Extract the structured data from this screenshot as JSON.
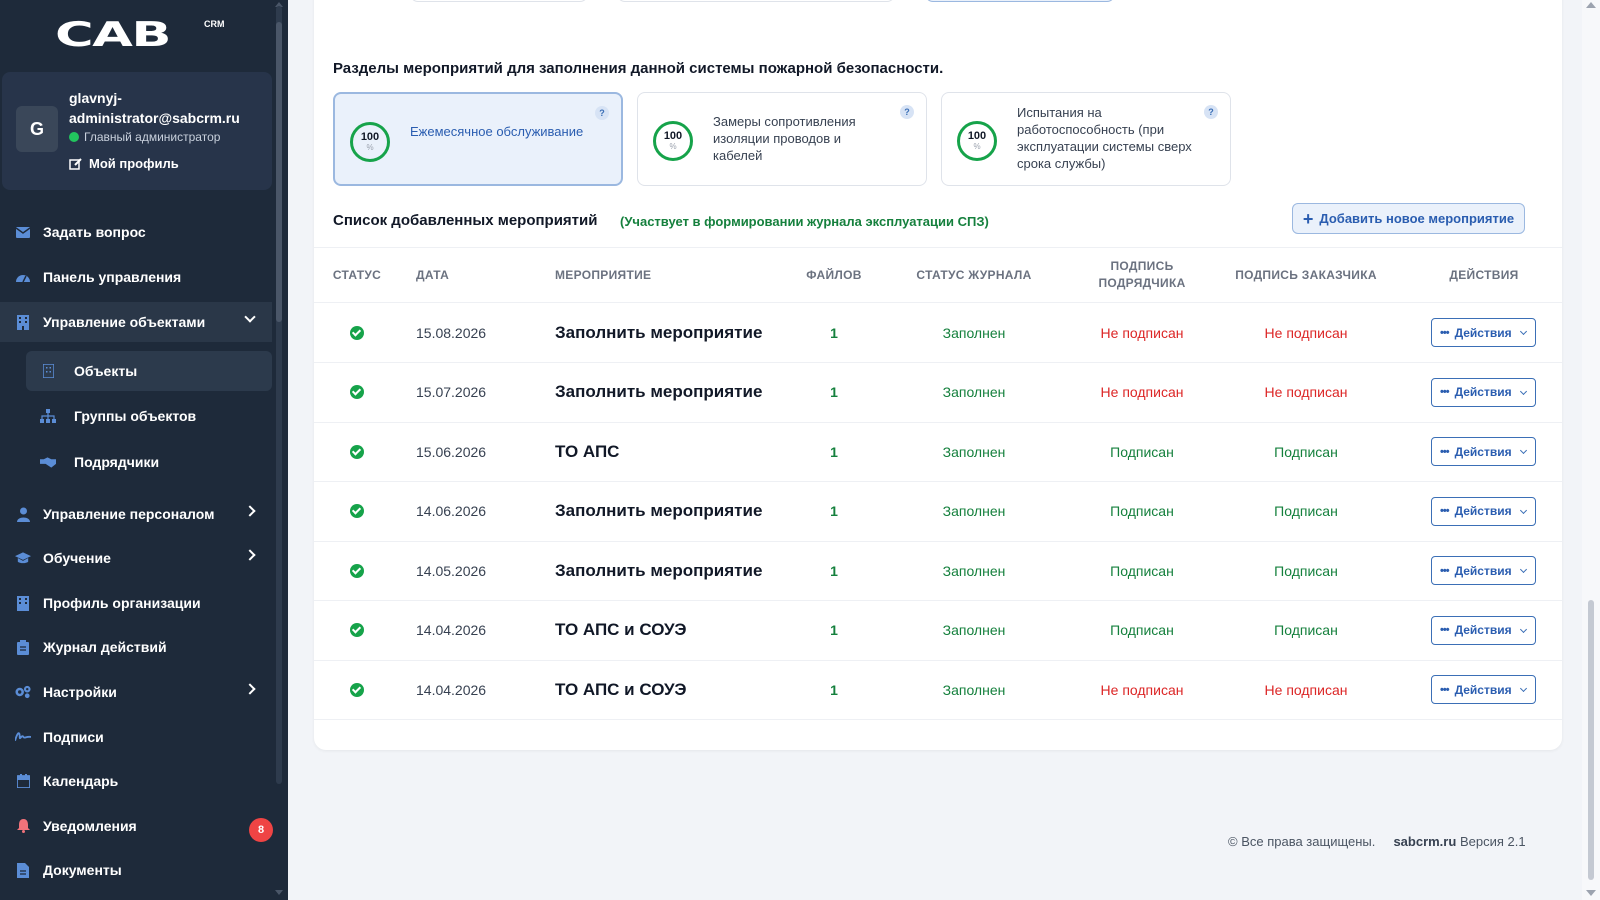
{
  "brand": {
    "logo_text": "CAB",
    "logo_sup": "CRM"
  },
  "profile": {
    "avatar_letter": "G",
    "name": "glavnyj-administrator@sabcrm.ru",
    "role": "Главный администратор",
    "profile_link": "Мой профиль"
  },
  "nav": {
    "ask": "Задать вопрос",
    "dashboard": "Панель управления",
    "objects_mgmt": "Управление объектами",
    "objects": "Объекты",
    "object_groups": "Группы объектов",
    "contractors": "Подрядчики",
    "staff": "Управление персоналом",
    "training": "Обучение",
    "org_profile": "Профиль организации",
    "action_log": "Журнал действий",
    "settings": "Настройки",
    "signatures": "Подписи",
    "calendar": "Календарь",
    "notifications": "Уведомления",
    "notifications_count": "8",
    "documents": "Документы"
  },
  "sections": {
    "title": "Разделы мероприятий для заполнения данной системы пожарной безопасности.",
    "cards": [
      {
        "value": "100",
        "unit": "%",
        "label": "Ежемесячное обслуживание"
      },
      {
        "value": "100",
        "unit": "%",
        "label": "Замеры сопротивления изоляции проводов и кабелей"
      },
      {
        "value": "100",
        "unit": "%",
        "label": "Испытания на работоспособность (при эксплуатации системы сверх срока службы)"
      }
    ],
    "help": "?"
  },
  "list": {
    "title": "Список добавленных мероприятий",
    "note": "(Участвует в формировании журнала эксплуатации СПЗ)",
    "add_button": "Добавить новое мероприятие",
    "headers": {
      "status": "Статус",
      "date": "Дата",
      "event": "Мероприятие",
      "files": "Файлов",
      "journal": "Статус журнала",
      "contractor_sign": "Подпись подрядчика",
      "customer_sign": "Подпись заказчика",
      "actions": "Действия"
    },
    "action_label": "Действия",
    "rows": [
      {
        "date": "15.08.2026",
        "event": "Заполнить мероприятие",
        "files": "1",
        "journal": "Заполнен",
        "contractor": "Не подписан",
        "customer": "Не подписан"
      },
      {
        "date": "15.07.2026",
        "event": "Заполнить мероприятие",
        "files": "1",
        "journal": "Заполнен",
        "contractor": "Не подписан",
        "customer": "Не подписан"
      },
      {
        "date": "15.06.2026",
        "event": "ТО АПС",
        "files": "1",
        "journal": "Заполнен",
        "contractor": "Подписан",
        "customer": "Подписан"
      },
      {
        "date": "14.06.2026",
        "event": "Заполнить мероприятие",
        "files": "1",
        "journal": "Заполнен",
        "contractor": "Подписан",
        "customer": "Подписан"
      },
      {
        "date": "14.05.2026",
        "event": "Заполнить мероприятие",
        "files": "1",
        "journal": "Заполнен",
        "contractor": "Подписан",
        "customer": "Подписан"
      },
      {
        "date": "14.04.2026",
        "event": "ТО АПС и СОУЭ",
        "files": "1",
        "journal": "Заполнен",
        "contractor": "Подписан",
        "customer": "Подписан"
      },
      {
        "date": "14.04.2026",
        "event": "ТО АПС и СОУЭ",
        "files": "1",
        "journal": "Заполнен",
        "contractor": "Не подписан",
        "customer": "Не подписан"
      }
    ]
  },
  "footer": {
    "rights": "© Все права защищены.",
    "site": "sabcrm.ru",
    "version": "Версия 2.1"
  },
  "colors": {
    "sidebar": "#1e2a3a",
    "accent": "#2a5db0",
    "success": "#16a34a",
    "danger": "#dc2626"
  }
}
